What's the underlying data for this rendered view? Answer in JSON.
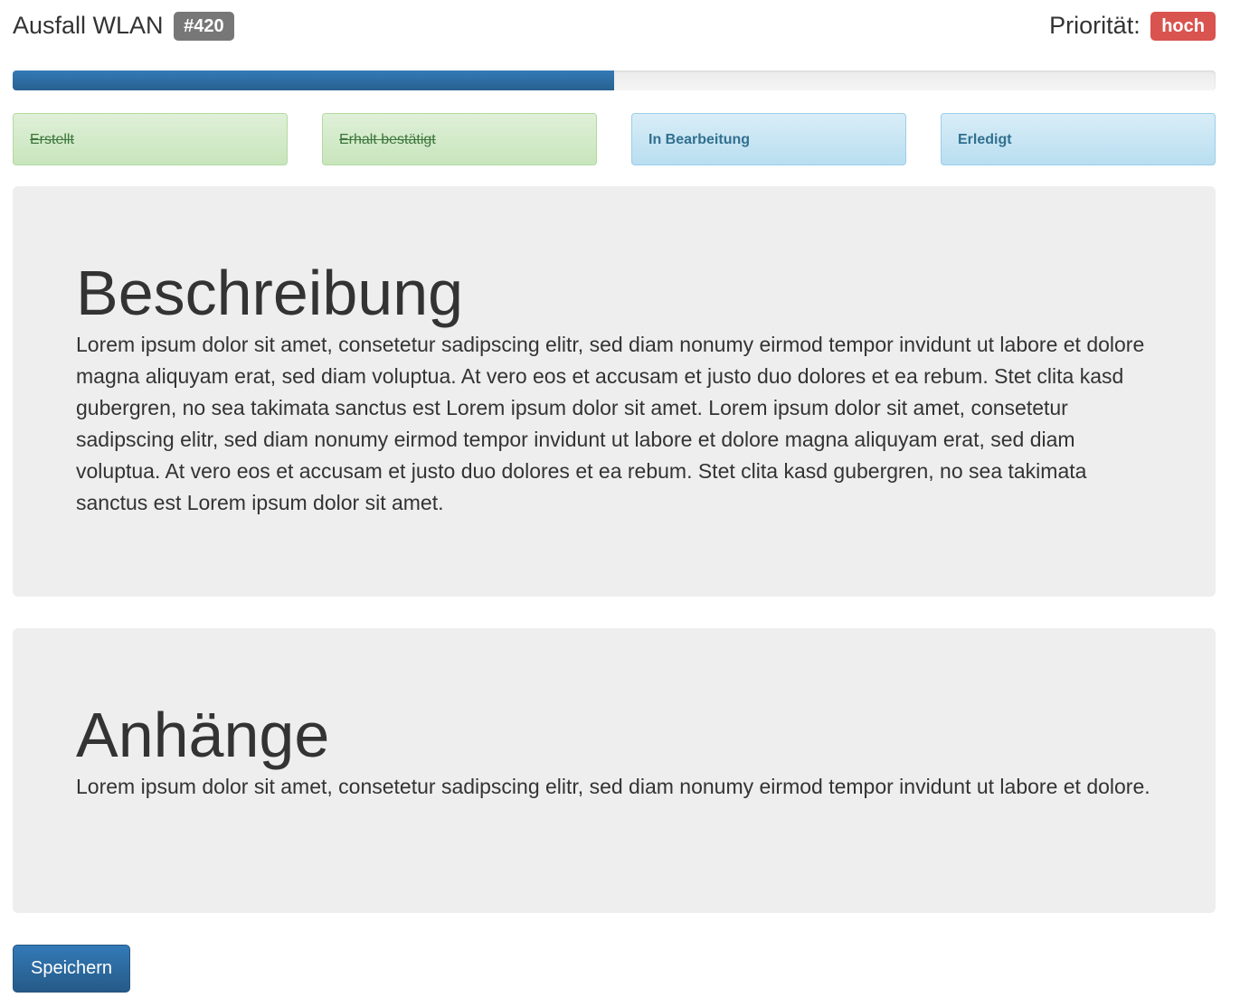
{
  "header": {
    "title": "Ausfall WLAN",
    "ticket_id": "#420",
    "priority_label": "Priorität:",
    "priority_value": "hoch"
  },
  "progress": {
    "percent": 50
  },
  "steps": [
    {
      "label": "Erstellt",
      "state": "done"
    },
    {
      "label": "Erhalt bestätigt",
      "state": "done"
    },
    {
      "label": "In Bearbeitung",
      "state": "open"
    },
    {
      "label": "Erledigt",
      "state": "open"
    }
  ],
  "description": {
    "heading": "Beschreibung",
    "text": "Lorem ipsum dolor sit amet, consetetur sadipscing elitr, sed diam nonumy eirmod tempor invidunt ut labore et dolore magna aliquyam erat, sed diam voluptua. At vero eos et accusam et justo duo dolores et ea rebum. Stet clita kasd gubergren, no sea takimata sanctus est Lorem ipsum dolor sit amet. Lorem ipsum dolor sit amet, consetetur sadipscing elitr, sed diam nonumy eirmod tempor invidunt ut labore et dolore magna aliquyam erat, sed diam voluptua. At vero eos et accusam et justo duo dolores et ea rebum. Stet clita kasd gubergren, no sea takimata sanctus est Lorem ipsum dolor sit amet."
  },
  "attachments": {
    "heading": "Anhänge",
    "text": "Lorem ipsum dolor sit amet, consetetur sadipscing elitr, sed diam nonumy eirmod tempor invidunt ut labore et dolore."
  },
  "actions": {
    "save_label": "Speichern"
  },
  "colors": {
    "primary": "#337ab7",
    "danger": "#d9534f",
    "badge_gray": "#777777",
    "success_bg": "#dff0d8",
    "info_bg": "#d9edf7",
    "panel_bg": "#eeeeee"
  }
}
